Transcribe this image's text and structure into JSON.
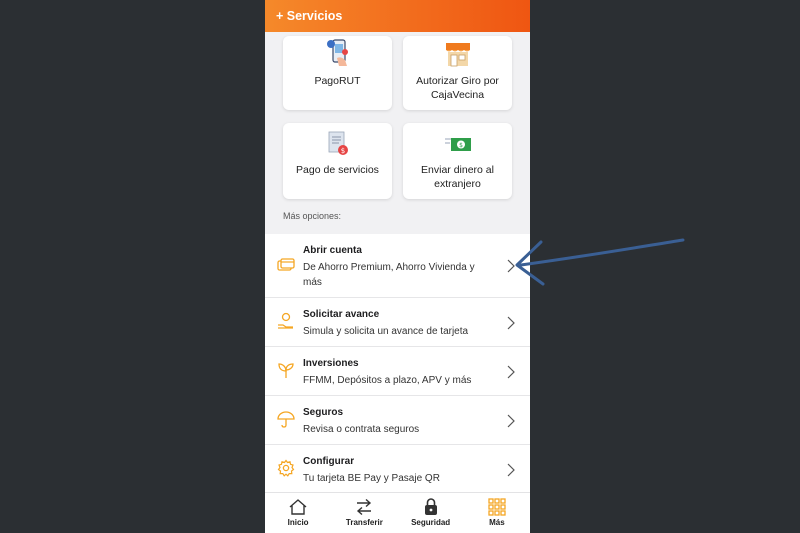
{
  "header": {
    "title": "+ Servicios"
  },
  "cards": [
    {
      "label": "PagoRUT",
      "icon": "phone-rut-icon"
    },
    {
      "label": "Autorizar Giro por CajaVecina",
      "icon": "storefront-icon"
    },
    {
      "label": "Pago de servicios",
      "icon": "bill-payment-icon"
    },
    {
      "label": "Enviar dinero al extranjero",
      "icon": "money-transfer-icon"
    }
  ],
  "more_label": "Más opciones:",
  "options": [
    {
      "title": "Abrir cuenta",
      "subtitle": "De Ahorro Premium, Ahorro Vivienda y más",
      "icon": "card-stack-icon"
    },
    {
      "title": "Solicitar avance",
      "subtitle": "Simula y solicita un avance de tarjeta",
      "icon": "hand-coin-icon"
    },
    {
      "title": "Inversiones",
      "subtitle": "FFMM, Depósitos a plazo, APV y más",
      "icon": "plant-icon"
    },
    {
      "title": "Seguros",
      "subtitle": "Revisa o contrata seguros",
      "icon": "umbrella-icon"
    },
    {
      "title": "Configurar",
      "subtitle": "Tu tarjeta BE Pay y Pasaje QR",
      "icon": "gear-icon"
    }
  ],
  "nav": [
    {
      "label": "Inicio",
      "icon": "home-icon"
    },
    {
      "label": "Transferir",
      "icon": "transfer-arrows-icon"
    },
    {
      "label": "Seguridad",
      "icon": "lock-icon"
    },
    {
      "label": "Más",
      "icon": "grid-icon"
    }
  ],
  "colors": {
    "accent": "#f5a623",
    "header": "#f26a1c",
    "annotation": "#3a5f94"
  }
}
